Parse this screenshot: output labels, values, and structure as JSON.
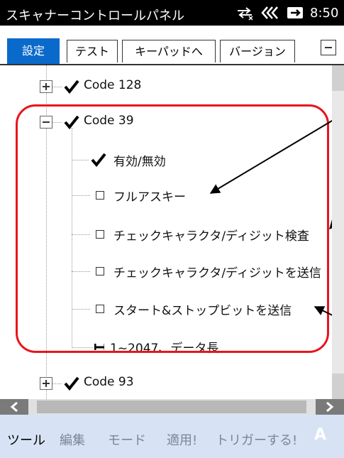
{
  "titlebar": {
    "title": "スキャナーコントロールパネル",
    "time": "8:50"
  },
  "tabs": [
    "設定",
    "テスト",
    "キーパッドへ",
    "バージョン"
  ],
  "tree": {
    "code128": {
      "label": "Code 128"
    },
    "code39": {
      "label": "Code 39",
      "children": [
        {
          "label": "有効/無効",
          "checked": true
        },
        {
          "label": "フルアスキー",
          "checked": false
        },
        {
          "label": "チェックキャラクタ/ディジット検査",
          "checked": false
        },
        {
          "label": "チェックキャラクタ/ディジットを送信",
          "checked": false
        },
        {
          "label": "スタート&ストップビットを送信",
          "checked": false
        },
        {
          "label": "1~2047、データ長"
        }
      ]
    },
    "code93": {
      "label": "Code 93"
    }
  },
  "menubar": {
    "items": [
      "ツール",
      "編集",
      "モード",
      "適用!",
      "トリガーする!"
    ],
    "input_indicator": "A"
  },
  "colors": {
    "highlight": "#e8141e",
    "tab_active": "#0a6acb",
    "menubar": "#d7e3f5"
  }
}
